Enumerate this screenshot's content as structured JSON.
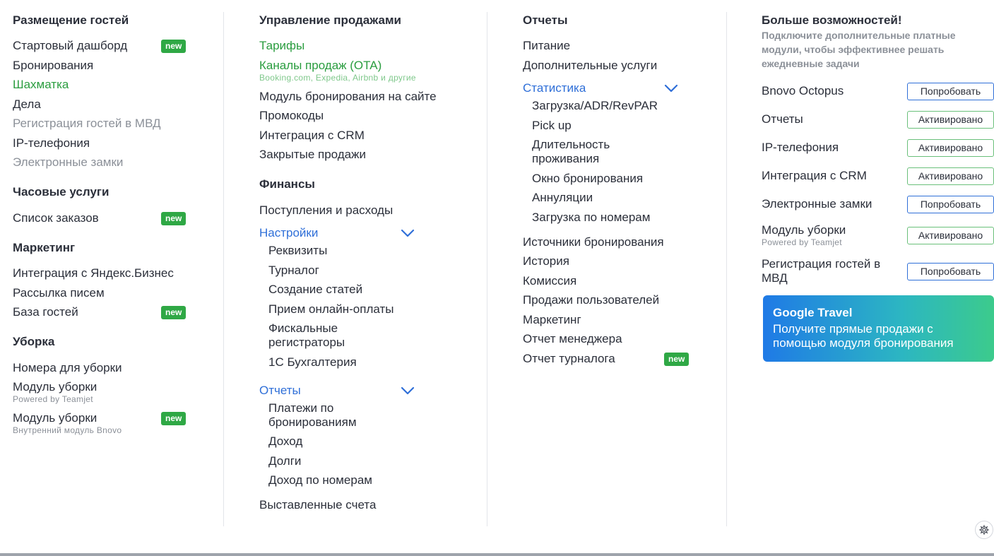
{
  "col1": {
    "accommodation": {
      "title": "Размещение гостей",
      "items": [
        "Стартовый дашборд",
        "Бронирования",
        "Шахматка",
        "Дела",
        "Регистрация гостей в МВД",
        "IP-телефония",
        "Электронные замки"
      ]
    },
    "hourly": {
      "title": "Часовые услуги",
      "items": [
        "Список заказов"
      ]
    },
    "marketing": {
      "title": "Маркетинг",
      "items": [
        "Интеграция с Яндекс.Бизнес",
        "Рассылка писем",
        "База гостей"
      ]
    },
    "cleaning": {
      "title": "Уборка",
      "items": [
        "Номера для уборки",
        "Модуль уборки",
        "Модуль уборки"
      ],
      "subs": [
        "Powered by Teamjet",
        "Внутренний модуль Bnovo"
      ]
    },
    "badge": "new"
  },
  "col2": {
    "sales": {
      "title": "Управление продажами",
      "items": [
        "Тарифы",
        "Каналы продаж (OTA)",
        "Модуль бронирования на сайте",
        "Промокоды",
        "Интеграция с CRM",
        "Закрытые продажи"
      ],
      "ota_sub": "Booking.com, Expedia, Airbnb и другие"
    },
    "finance": {
      "title": "Финансы",
      "items": [
        "Поступления и расходы",
        "Настройки"
      ],
      "settings_items": [
        "Реквизиты",
        "Турналог",
        "Создание статей",
        "Прием онлайн-оплаты",
        "Фискальные регистраторы",
        "1С Бухгалтерия"
      ],
      "reports_label": "Отчеты",
      "reports_items": [
        "Платежи по бронированиям",
        "Доход",
        "Долги",
        "Доход по номерам"
      ],
      "invoices": "Выставленные счета"
    }
  },
  "col3": {
    "title": "Отчеты",
    "items": [
      "Питание",
      "Дополнительные услуги",
      "Статистика"
    ],
    "stats_items": [
      "Загрузка/ADR/RevPAR",
      "Pick up",
      "Длительность проживания",
      "Окно бронирования",
      "Аннуляции",
      "Загрузка по номерам"
    ],
    "more_items": [
      "Источники бронирования",
      "История",
      "Комиссия",
      "Продажи пользователей",
      "Маркетинг",
      "Отчет менеджера",
      "Отчет турналога"
    ],
    "badge": "new"
  },
  "col4": {
    "title": "Больше возможностей!",
    "subtitle": "Подключите дополнительные платные модули, чтобы эффективнее решать ежедневные задачи",
    "modules": [
      {
        "name": "Bnovo Octopus",
        "sub": "",
        "button": "Попробовать",
        "state": "try"
      },
      {
        "name": "Отчеты",
        "sub": "",
        "button": "Активировано",
        "state": "active"
      },
      {
        "name": "IP-телефония",
        "sub": "",
        "button": "Активировано",
        "state": "active"
      },
      {
        "name": "Интеграция с CRM",
        "sub": "",
        "button": "Активировано",
        "state": "active"
      },
      {
        "name": "Электронные замки",
        "sub": "",
        "button": "Попробовать",
        "state": "try"
      },
      {
        "name": "Модуль уборки",
        "sub": "Powered by Teamjet",
        "button": "Активировано",
        "state": "active"
      },
      {
        "name": "Регистрация гостей в МВД",
        "sub": "",
        "button": "Попробовать",
        "state": "try"
      }
    ],
    "google_travel": {
      "title": "Google Travel",
      "text": "Получите прямые продажи с помощью модуля бронирования"
    }
  },
  "colors": {
    "green": "#2a9d3f",
    "blue": "#2f6fd8",
    "badge": "#2fa845",
    "gray": "#8b9098"
  },
  "icons": {
    "chevron": "chevron-down-icon",
    "settings": "gear-icon"
  }
}
